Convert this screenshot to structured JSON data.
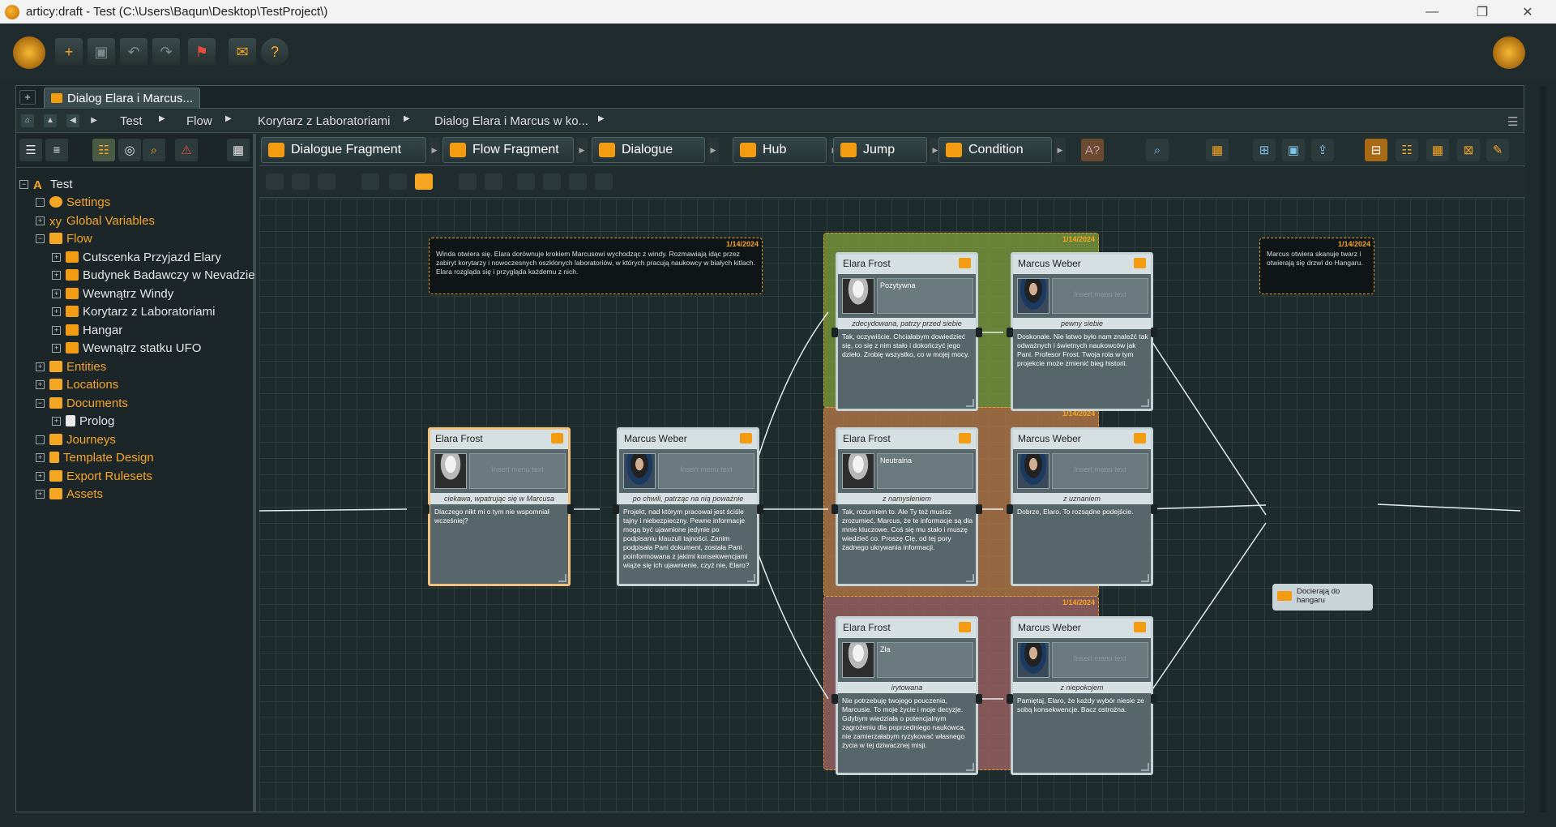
{
  "window": {
    "title": "articy:draft - Test (C:\\Users\\Baqun\\Desktop\\TestProject\\)",
    "min": "—",
    "max": "❐",
    "close": "✕"
  },
  "toolbar": {
    "new": "+",
    "help": "?"
  },
  "tab": {
    "add": "+",
    "label": "Dialog Elara i Marcus..."
  },
  "breadcrumb": [
    "Test",
    "Flow",
    "Korytarz z Laboratoriami",
    "Dialog Elara i Marcus w ko..."
  ],
  "tree": {
    "root": "Test",
    "items": [
      {
        "label": "Settings"
      },
      {
        "label": "Global Variables"
      },
      {
        "label": "Flow"
      },
      {
        "label": "Cutscenka Przyjazd Elary"
      },
      {
        "label": "Budynek Badawczy w Nevadzie"
      },
      {
        "label": "Wewnątrz Windy"
      },
      {
        "label": "Korytarz z Laboratoriami"
      },
      {
        "label": "Hangar"
      },
      {
        "label": "Wewnątrz statku UFO"
      },
      {
        "label": "Entities"
      },
      {
        "label": "Locations"
      },
      {
        "label": "Documents"
      },
      {
        "label": "Prolog"
      },
      {
        "label": "Journeys"
      },
      {
        "label": "Template Design"
      },
      {
        "label": "Export Rulesets"
      },
      {
        "label": "Assets"
      }
    ]
  },
  "tools": [
    "Dialogue Fragment",
    "Flow Fragment",
    "Dialogue",
    "Hub",
    "Jump",
    "Condition"
  ],
  "notes": [
    {
      "date": "1/14/2024",
      "text": "Winda otwiera się. Elara dorównuje krokiem Marcusowi wychodząc z windy. Rozmawiają idąc przez zabiryt korytarzy i nowoczesnych oszklonych laboratoriów, w których pracują naukowcy w białych kitlach. Elara rozgląda się i przygląda każdemu z nich."
    },
    {
      "date": "1/14/2024",
      "text": "Marcus otwiera skanuje twarz i otwierają się drzwi do Hangaru."
    }
  ],
  "groups": [
    {
      "date": "1/14/2024"
    },
    {
      "date": "1/14/2024"
    },
    {
      "date": "1/14/2024"
    }
  ],
  "cards": [
    {
      "speaker": "Elara Frost",
      "menu": "Insert menu text",
      "stage": "ciekawa, wpatrując się w Marcusa",
      "text": "Dlaczego nikt mi o tym nie wspomniał wcześniej?"
    },
    {
      "speaker": "Marcus Weber",
      "menu": "Insert menu text",
      "stage": "po chwili, patrząc na nią poważnie",
      "text": "Projekt, nad którym pracował jest ściśle tajny i niebezpieczny. Pewne informacje mogą być ujawnione jedynie po podpisaniu klauzuli tajności. Zanim podpisała Pani dokument, została Pani poinformowana z jakimi konsekwencjami wiąże się ich ujawnienie, czyż nie, Elaro?"
    },
    {
      "speaker": "Elara Frost",
      "menu": "Pozytywna",
      "stage": "zdecydowana, patrzy przed siebie",
      "text": "Tak, oczywiście. Chciałabym dowiedzieć się, co się z nim stało i dokończyć jego dzieło. Zrobię wszystko, co w mojej mocy."
    },
    {
      "speaker": "Marcus Weber",
      "menu": "Insert menu text",
      "stage": "pewny siebie",
      "text": "Doskonale. Nie łatwo było nam znaleźć tak odważnych i świetnych naukowców jak Pani. Profesor Frost. Twoja rola w tym projekcie może zmienić bieg historii."
    },
    {
      "speaker": "Elara Frost",
      "menu": "Neutralna",
      "stage": "z namysłeniem",
      "text": "Tak, rozumiem to. Ale Ty też musisz zrozumieć, Marcus, że te informacje są dla mnie kluczowe. Coś się mu stało i muszę wiedzieć co. Proszę Cię, od tej pory żadnego ukrywania informacji."
    },
    {
      "speaker": "Marcus Weber",
      "menu": "Insert menu text",
      "stage": "z uznaniem",
      "text": "Dobrze, Elaro. To rozsądne podejście."
    },
    {
      "speaker": "Elara Frost",
      "menu": "Zła",
      "stage": "irytowana",
      "text": "Nie potrzebuję twojego pouczenia, Marcusie. To moje życie i moje decyzje. Gdybym wiedziała o potencjalnym zagrożeniu dla poprzedniego naukowca, nie zamierzałabym ryzykować własnego życia w tej dziwacznej misji."
    },
    {
      "speaker": "Marcus Weber",
      "menu": "Insert menu text",
      "stage": "z niepokojem",
      "text": "Pamiętaj, Elaro, że każdy wybór niesie ze sobą konsekwencje. Bacz ostrożna."
    }
  ],
  "jump": {
    "label": "Docierają do hangaru"
  }
}
